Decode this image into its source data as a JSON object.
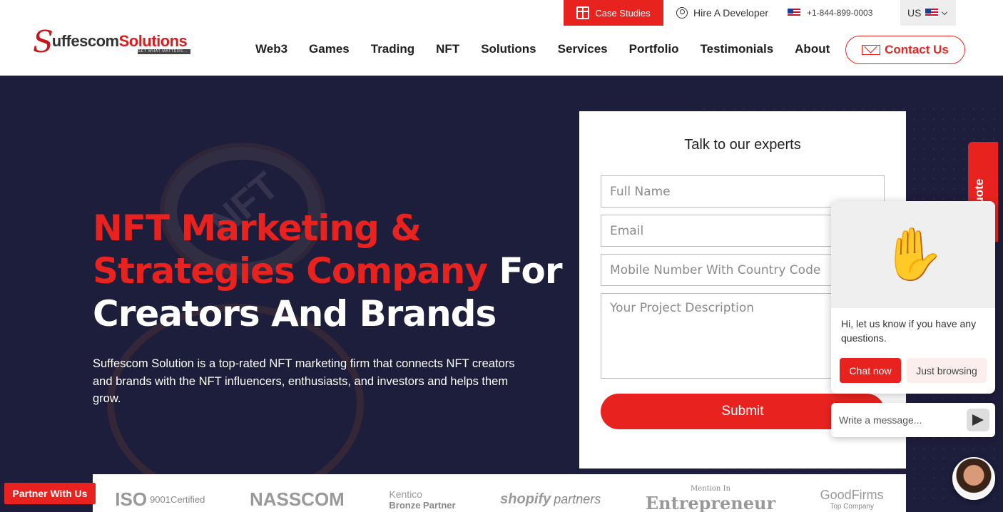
{
  "topbar": {
    "case_studies": "Case Studies",
    "hire": "Hire A Developer",
    "phone": "+1-844-899-0003",
    "country": "US"
  },
  "logo": {
    "part1": "uffescom",
    "part2": "Solutions",
    "tagline": "GET WHAT MATTERS..."
  },
  "nav": {
    "items": [
      "Web3",
      "Games",
      "Trading",
      "NFT",
      "Solutions",
      "Services",
      "Portfolio",
      "Testimonials",
      "About"
    ],
    "contact": "Contact Us"
  },
  "hero": {
    "title_red": "NFT Marketing & Strategies Company",
    "title_white": "For Creators And Brands",
    "description": "Suffescom Solution is a top-rated NFT marketing firm that connects NFT creators and brands with the NFT influencers, enthusiasts, and investors and helps them grow.",
    "bg_text": "NFT"
  },
  "form": {
    "title": "Talk to our experts",
    "full_name": "Full Name",
    "email": "Email",
    "mobile": "Mobile Number With Country Code",
    "description": "Your Project Description",
    "submit": "Submit"
  },
  "quote_tab": "e Quote",
  "logos": [
    {
      "main": "ISO",
      "sub": "9001Certified"
    },
    {
      "main": "NASSCOM",
      "sub": ""
    },
    {
      "main": "Kentico",
      "sub": "Bronze Partner"
    },
    {
      "main": "shopify",
      "sub": "partners"
    },
    {
      "main": "Entrepreneur",
      "sub": "Mention In"
    },
    {
      "main": "GoodFirms",
      "sub": "Top Company"
    }
  ],
  "partner_button": "Partner With Us",
  "chat": {
    "message": "Hi, let us know if you have any questions.",
    "chat_now": "Chat now",
    "just_browsing": "Just browsing",
    "input_placeholder": "Write a message..."
  },
  "colors": {
    "accent": "#e8231f",
    "hero_bg": "#1d1d3c"
  }
}
